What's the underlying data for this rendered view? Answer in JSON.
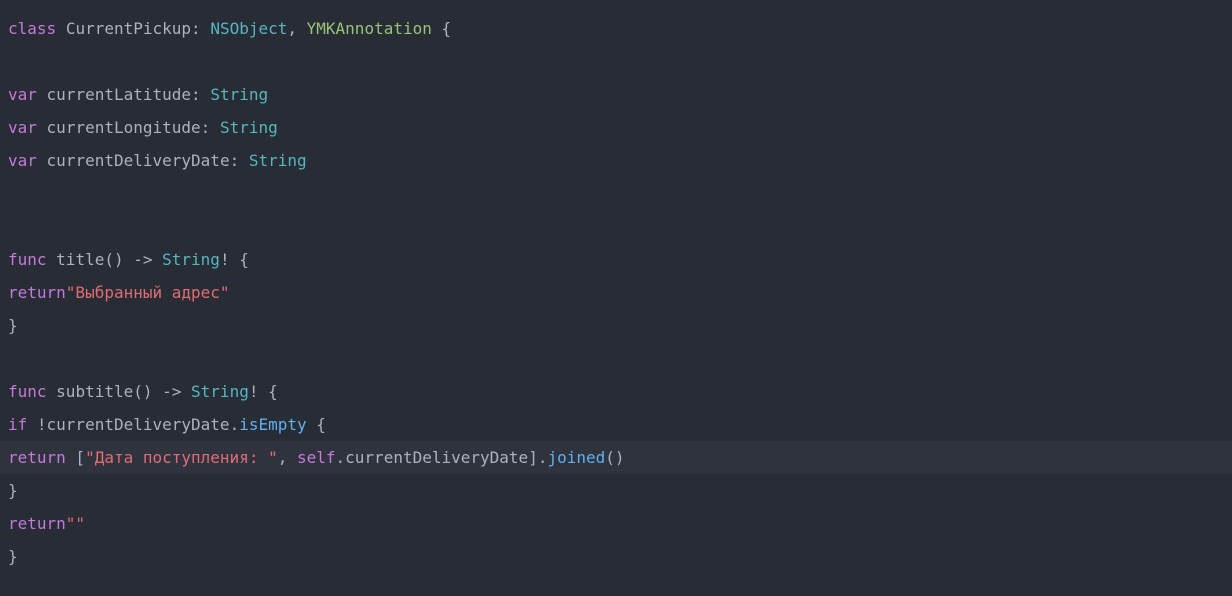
{
  "code": {
    "l1": {
      "kw_class": "class",
      "name": "CurrentPickup",
      "colon": ": ",
      "t1": "NSObject",
      "comma": ", ",
      "t2": "YMKAnnotation",
      "brace": " {"
    },
    "l3": {
      "kw_var": "var",
      "name": "currentLatitude",
      "colon": ": ",
      "type": "String"
    },
    "l4": {
      "kw_var": "var",
      "name": "currentLongitude",
      "colon": ": ",
      "type": "String"
    },
    "l5": {
      "kw_var": "var",
      "name": "currentDeliveryDate",
      "colon": ": ",
      "type": "String"
    },
    "l8": {
      "kw_func": "func",
      "name": "title",
      "parens": "() -> ",
      "type": "String",
      "bang_brace": "! {"
    },
    "l9": {
      "kw_return": "return",
      "str": "\"Выбранный адрес\""
    },
    "l10": {
      "brace": "}"
    },
    "l12": {
      "kw_func": "func",
      "name": "subtitle",
      "parens": "() -> ",
      "type": "String",
      "bang_brace": "! {"
    },
    "l13": {
      "kw_if": "if",
      "bang": " !",
      "name": "currentDeliveryDate",
      "dot": ".",
      "prop": "isEmpty",
      "brace": " {"
    },
    "l14": {
      "kw_return": "return",
      "lbracket": " [",
      "str1": "\"Дата поступления: \"",
      "comma": ", ",
      "kw_self": "self",
      "dot": ".",
      "name": "currentDeliveryDate",
      "rbracket": "].",
      "method": "joined",
      "call": "()"
    },
    "l15": {
      "brace": "}"
    },
    "l16": {
      "kw_return": "return",
      "str": "\"\""
    },
    "l17": {
      "brace": "}"
    }
  }
}
